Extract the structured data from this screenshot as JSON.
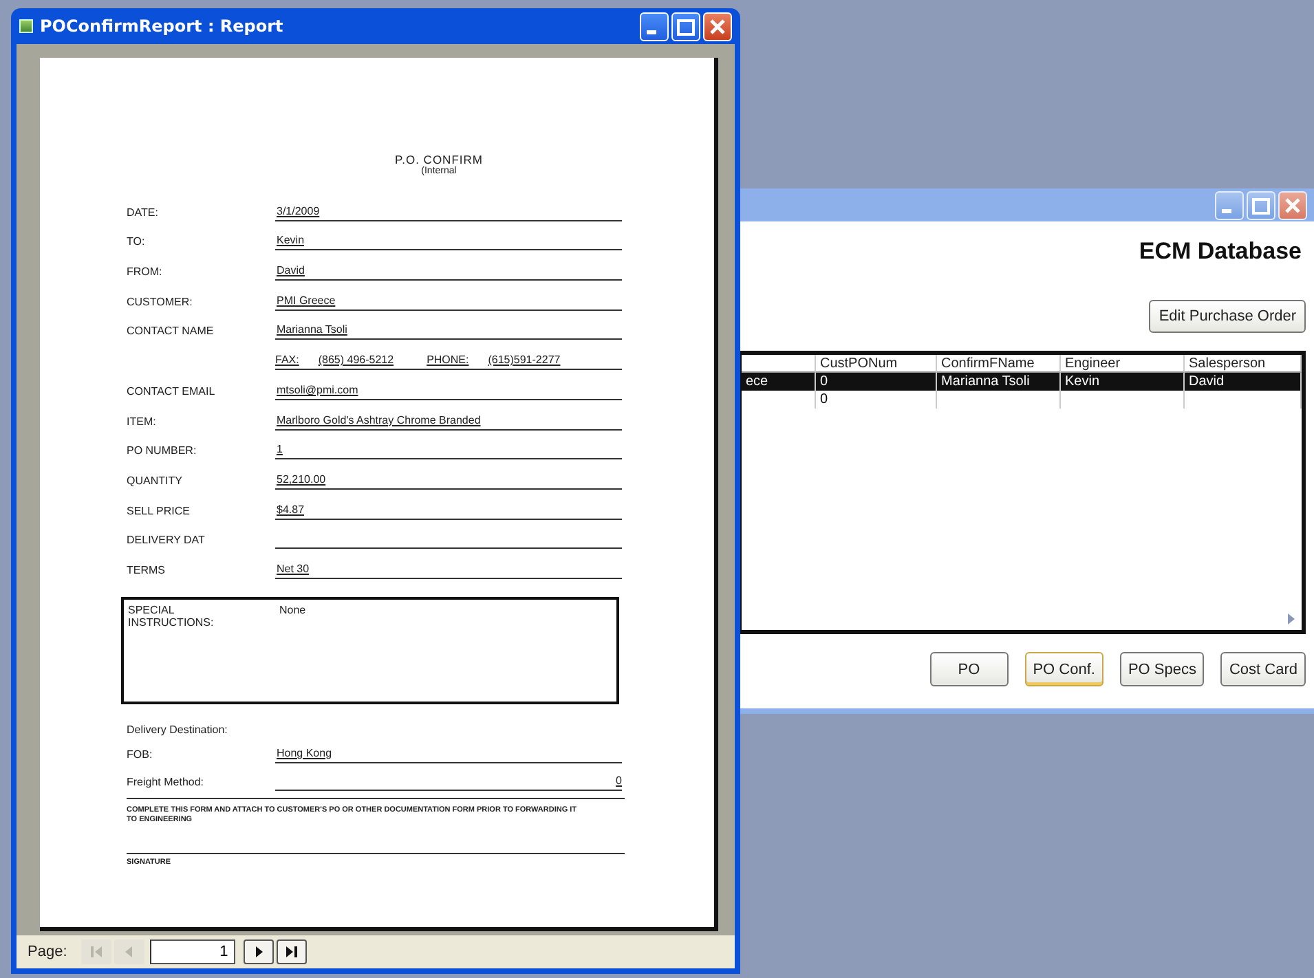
{
  "report_window": {
    "title": "POConfirmReport : Report",
    "heading": "P.O. CONFIRM",
    "subheading": "(Internal",
    "fields": [
      {
        "kind": "line",
        "label": "DATE:",
        "value": "3/1/2009"
      },
      {
        "kind": "line",
        "label": "TO:",
        "value": "Kevin"
      },
      {
        "kind": "line",
        "label": "FROM:",
        "value": "David"
      },
      {
        "kind": "line",
        "label": "CUSTOMER:",
        "value": "PMI Greece"
      },
      {
        "kind": "line",
        "label": "CONTACT NAME",
        "value": "Marianna Tsoli"
      },
      {
        "kind": "phones",
        "fax_label": "FAX:",
        "fax": "(865) 496-5212",
        "phone_label": "PHONE:",
        "phone": "(615)591-2277"
      },
      {
        "kind": "line",
        "label": "CONTACT EMAIL",
        "value": "mtsoli@pmi.com"
      },
      {
        "kind": "line",
        "label": "ITEM:",
        "value": "Marlboro Gold's Ashtray Chrome Branded"
      },
      {
        "kind": "line",
        "label": "PO NUMBER:",
        "value": "1"
      },
      {
        "kind": "line",
        "label": "QUANTITY",
        "value": "52,210.00"
      },
      {
        "kind": "line",
        "label": "SELL PRICE",
        "value": "$4.87"
      },
      {
        "kind": "line",
        "label": "DELIVERY DAT"
      },
      {
        "kind": "line",
        "label": "TERMS",
        "value": "Net 30"
      }
    ],
    "special_instructions": {
      "label": "SPECIAL INSTRUCTIONS:",
      "value": "None"
    },
    "delivery_heading": "Delivery Destination:",
    "delivery_fields": [
      {
        "kind": "text",
        "label": "FOB:",
        "value": "Hong Kong"
      },
      {
        "kind": "amount",
        "label": "Freight Method:",
        "value": "0"
      }
    ],
    "notice": "COMPLETE THIS FORM AND ATTACH TO CUSTOMER'S PO OR OTHER DOCUMENTATION FORM PRIOR TO FORWARDING IT TO ENGINEERING",
    "signature_label": "SIGNATURE",
    "navigation": {
      "label": "Page:",
      "page": "1",
      "first_disabled": true,
      "previous_disabled": true,
      "next_disabled": false,
      "last_disabled": false
    }
  },
  "database_window": {
    "heading": "ECM Database",
    "edit_button": "Edit Purchase Order",
    "table": {
      "columns": [
        null,
        "CustPONum",
        "ConfirmFName",
        "Engineer",
        "Salesperson"
      ],
      "rows": [
        {
          "selected": true,
          "cells": [
            "ece",
            "0",
            "Marianna Tsoli",
            "Kevin",
            "David"
          ]
        },
        {
          "selected": false,
          "cells": [
            null,
            "0",
            null,
            null,
            null
          ]
        }
      ]
    },
    "buttons": [
      {
        "label": "PO",
        "focused": false
      },
      {
        "label": "PO Conf.",
        "focused": true
      },
      {
        "label": "PO Specs",
        "focused": false
      },
      {
        "label": "Cost Card",
        "focused": false
      }
    ]
  }
}
